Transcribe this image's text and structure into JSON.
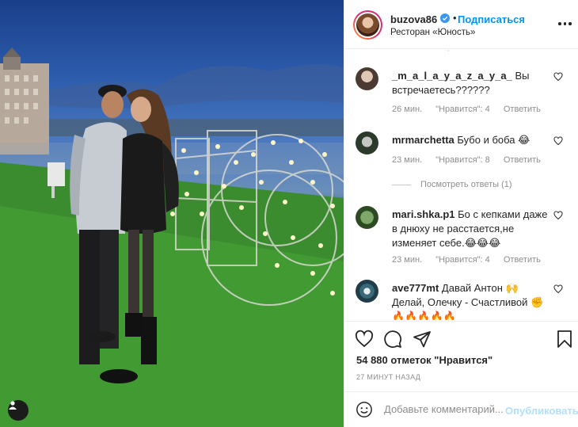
{
  "post": {
    "username": "buzova86",
    "follow_label": "Подписаться",
    "dot": "•",
    "location": "Ресторан «Юность»",
    "likes": "54 880 отметок \"Нравится\"",
    "timestamp": "27 МИНУТ НАЗАД"
  },
  "comments": [
    {
      "user": "_m_a_l_a_y_a_z_a_y_a_",
      "text": "Вы встречаетесь??????",
      "time": "26 мин.",
      "likes": "\"Нравится\": 4",
      "reply": "Ответить"
    },
    {
      "user": "mrmarchetta",
      "text": "Бубо и боба 😂",
      "time": "23 мин.",
      "likes": "\"Нравится\": 8",
      "reply": "Ответить"
    },
    {
      "user": "mari.shka.p1",
      "text": "Бо с кепками даже в днюху не расстается,не изменяет себе.😂😂😂",
      "time": "23 мин.",
      "likes": "\"Нравится\": 4",
      "reply": "Ответить"
    },
    {
      "user": "ave777mt",
      "text": "Давай Антон 🙌 Делай, Олечку - Счастливой ✊ 🔥🔥🔥🔥🔥",
      "time": "",
      "likes": "",
      "reply": ""
    }
  ],
  "view_replies": "Посмотреть ответы (1)",
  "add_comment": {
    "placeholder": "Добавьте комментарий...",
    "publish_label": "Опубликовать"
  },
  "icons": [
    "heart-icon",
    "comment-icon",
    "share-icon",
    "bookmark-icon",
    "emoji-icon",
    "more-icon",
    "verified-icon",
    "user-tag-icon"
  ],
  "colors": {
    "accent": "#0095f6",
    "publish_disabled": "#b2dffc",
    "text": "#262626",
    "muted": "#8e8e8e"
  }
}
